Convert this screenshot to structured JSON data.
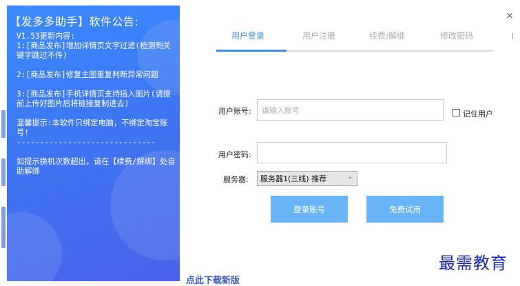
{
  "notice": {
    "title": "【发多多助手】软件公告:",
    "body": "V1.53更新内容:\n1:[商品发布]增加详情页文字过滤(检测到关键字跳过不传)\n\n2:[商品发布]修复主图重复判断异常问题\n\n3:[商品发布]手机详情页支持插入图片(请提前上传好图片后将链接复制进去)\n\n温馨提示:本软件只绑定电脑，不绑定淘宝账号!\n------------------------------\n\n如提示换机次数超出，请在【续费/解绑】处自助解绑"
  },
  "tabs": [
    {
      "label": "用户登录",
      "active": true
    },
    {
      "label": "用户注册",
      "active": false
    },
    {
      "label": "续费/解绑",
      "active": false
    },
    {
      "label": "修改密码",
      "active": false
    }
  ],
  "form": {
    "account_label": "用户账号:",
    "account_placeholder": "请输入账号",
    "account_value": "",
    "remember_label": "记住用户",
    "remember_checked": false,
    "password_label": "用户密码:",
    "password_value": "",
    "server_label": "服务器:",
    "server_selected": "服务器1(三线) 推荐"
  },
  "buttons": {
    "login": "登录账号",
    "trial": "免费试用"
  },
  "window": {
    "close_glyph": "×"
  },
  "watermark": "最需教育",
  "footer_link": "点此下载新版",
  "colors": {
    "accent": "#3b8de8",
    "button": "#68b4f6",
    "notice_bg_top": "#3c8bff",
    "notice_bg_bottom": "#4a62ea"
  }
}
